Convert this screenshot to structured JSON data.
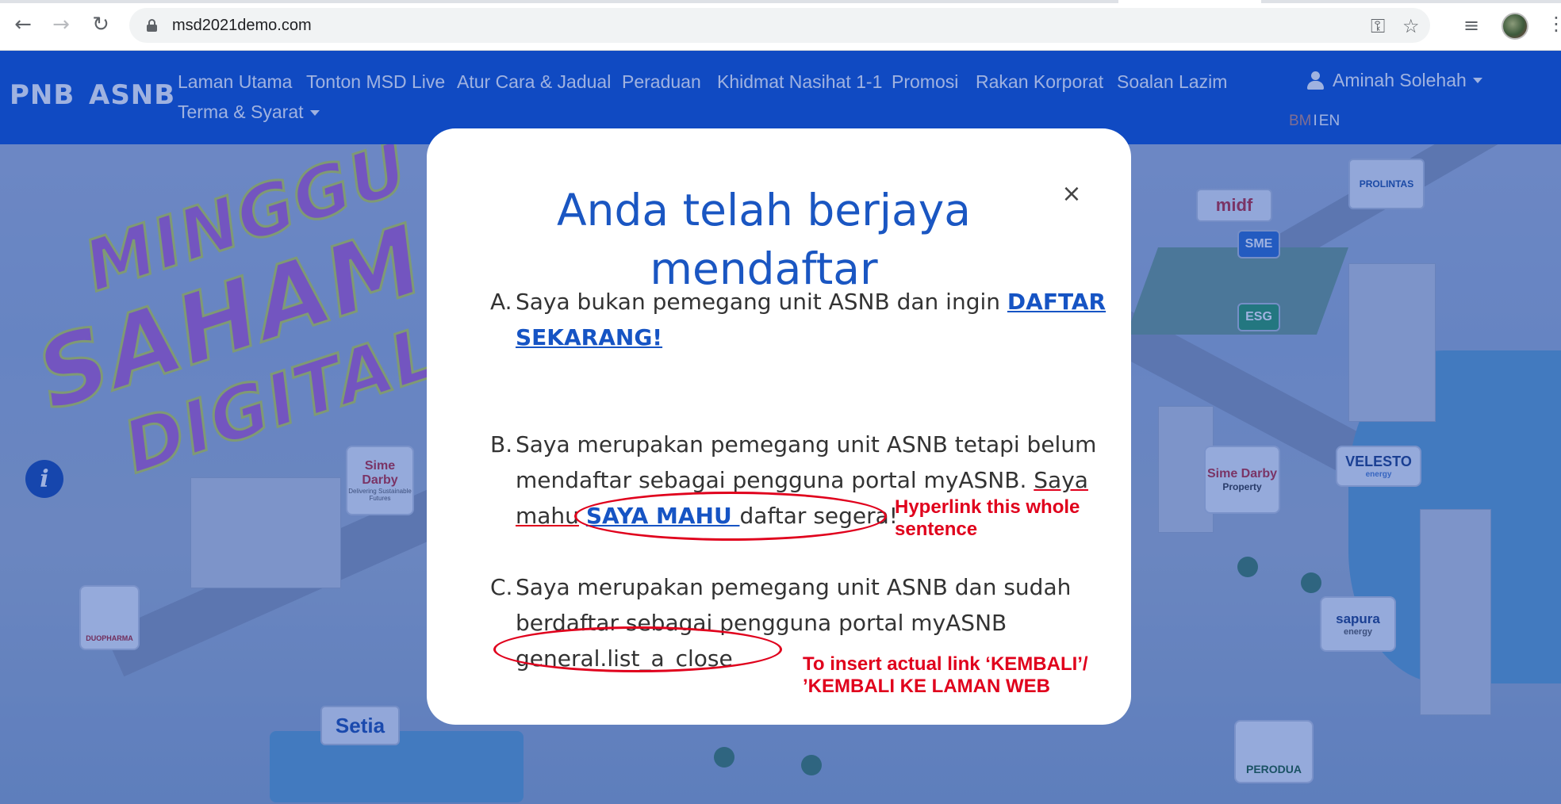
{
  "browser": {
    "url": "msd2021demo.com",
    "back_icon": "arrow-left-icon",
    "forward_icon": "arrow-right-icon",
    "reload_icon": "reload-icon",
    "key_icon": "key-icon",
    "star_icon": "star-icon",
    "media_icon": "media-queue-icon",
    "menu_icon": "kebab-menu-icon"
  },
  "header": {
    "brand_1": "PNB",
    "brand_2": "ASNB",
    "nav": [
      "Laman Utama",
      "Tonton MSD Live",
      "Atur Cara & Jadual",
      "Peraduan",
      "Khidmat Nasihat 1-1",
      "Promosi",
      "Rakan Korporat",
      "Soalan Lazim",
      "Terma & Syarat"
    ],
    "user_name": "Aminah Solehah",
    "lang_bm": "BM",
    "lang_sep": "I",
    "lang_en": "EN",
    "accent_color": "#0a4ccc"
  },
  "scene": {
    "title_art": [
      "MINGGU",
      "SAHAM",
      "DIGITAL"
    ],
    "logos": {
      "sime_darby": "Sime Darby",
      "sime_darby_tag": "Delivering Sustainable Futures",
      "sime_darby_property": "Sime Darby",
      "sime_darby_property_tag": "Property",
      "midf": "midf",
      "prolintas": "PROLINTAS",
      "velesto": "VELESTO",
      "velesto_tag": "energy",
      "sapura": "sapura",
      "sapura_tag": "energy",
      "setia": "Setia",
      "perodua": "PERODUA",
      "duopharma": "DUOPHARMA",
      "sme": "SME",
      "esg": "ESG"
    }
  },
  "modal": {
    "title_line_1": "Anda telah berjaya",
    "title_line_2": "mendaftar",
    "close_label": "×",
    "options": {
      "a_letter": "A.",
      "a_text": "Saya bukan pemegang unit ASNB dan ingin ",
      "a_link_1": "DAFTAR",
      "a_link_2": "SEKARANG!",
      "b_letter": "B.",
      "b_line_1": "Saya merupakan pemegang unit ASNB tetapi belum",
      "b_line_2_text": "mendaftar sebagai pengguna portal myASNB. ",
      "b_line_2_saya": "Saya",
      "b_line_3_mahu": "mahu",
      "b_line_3_link": "SAYA MAHU ",
      "b_line_3_rest": "daftar segera!",
      "c_letter": "C.",
      "c_line_1": "Saya merupakan pemegang unit ASNB dan sudah",
      "c_line_2": "berdaftar sebagai pengguna portal myASNB",
      "c_line_3": "general.list_a_close"
    }
  },
  "annotations": {
    "hyperlink_note_1": "Hyperlink this whole",
    "hyperlink_note_2": "sentence",
    "insert_note_1": "To insert actual link ‘KEMBALI’/",
    "insert_note_2": "’KEMBALI KE LAMAN WEB",
    "color": "#e0001c"
  }
}
